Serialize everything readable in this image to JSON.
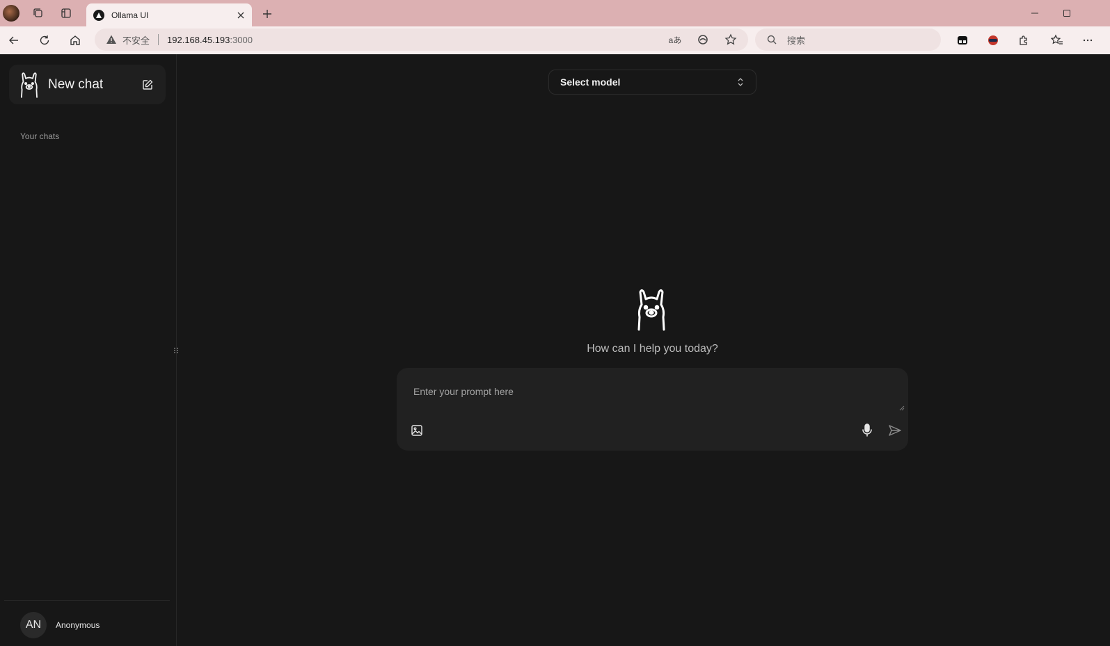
{
  "browser": {
    "tab_title": "Ollama UI",
    "address": {
      "security_label": "不安全",
      "host": "192.168.45.193",
      "port": ":3000"
    },
    "search_placeholder": "搜索"
  },
  "sidebar": {
    "new_chat_label": "New chat",
    "section_label": "Your chats",
    "user": {
      "initials": "AN",
      "name": "Anonymous"
    }
  },
  "main": {
    "model_select_label": "Select model",
    "greeting": "How can I help you today?",
    "prompt_placeholder": "Enter your prompt here"
  },
  "colors": {
    "app_background": "#171717",
    "composer_background": "#212121",
    "browser_frame": "#dcb0b2"
  },
  "icons": [
    "collections-icon",
    "tab-actions-icon",
    "close-icon",
    "plus-icon",
    "minimize-icon",
    "maximize-icon",
    "back-icon",
    "refresh-icon",
    "home-icon",
    "warning-icon",
    "translate-icon",
    "edge-icon",
    "favorite-star-icon",
    "search-icon",
    "extensions-icon",
    "favorites-icon",
    "more-icon",
    "llama-logo-icon",
    "edit-icon",
    "chevron-updown-icon",
    "image-icon",
    "microphone-icon",
    "send-icon"
  ]
}
